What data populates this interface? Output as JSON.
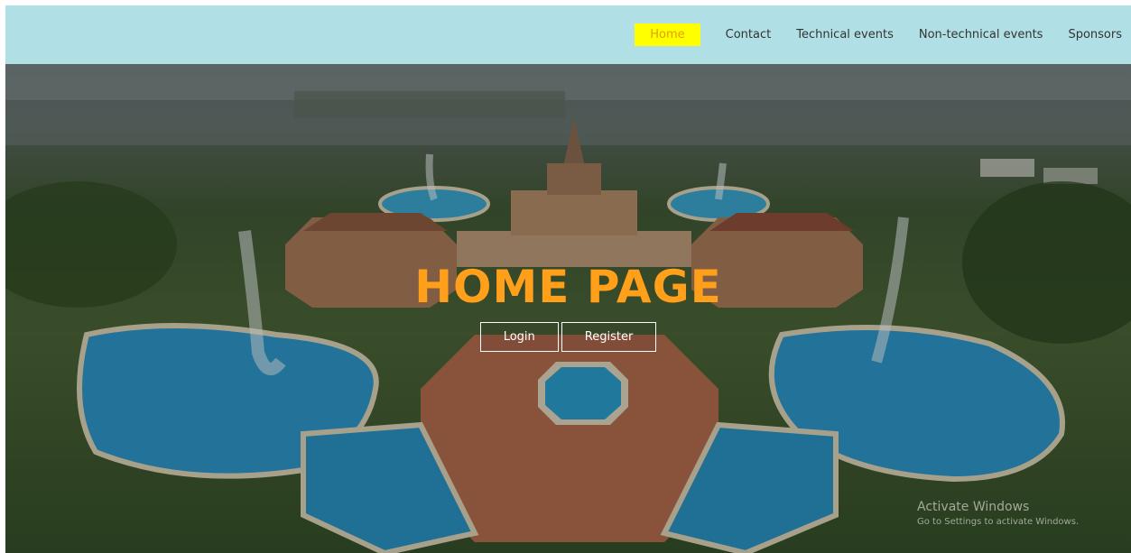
{
  "nav": {
    "items": [
      {
        "label": "Home",
        "active": true
      },
      {
        "label": "Contact",
        "active": false
      },
      {
        "label": "Technical events",
        "active": false
      },
      {
        "label": "Non-technical events",
        "active": false
      },
      {
        "label": "Sponsors",
        "active": false
      }
    ]
  },
  "hero": {
    "title": "HOME PAGE",
    "login_label": "Login",
    "register_label": "Register"
  },
  "watermark": {
    "title": "Activate Windows",
    "subtitle": "Go to Settings to activate Windows."
  },
  "colors": {
    "navbar_bg": "#b0e0e6",
    "active_bg": "#ffff00",
    "title_color": "#ff9f1a"
  }
}
